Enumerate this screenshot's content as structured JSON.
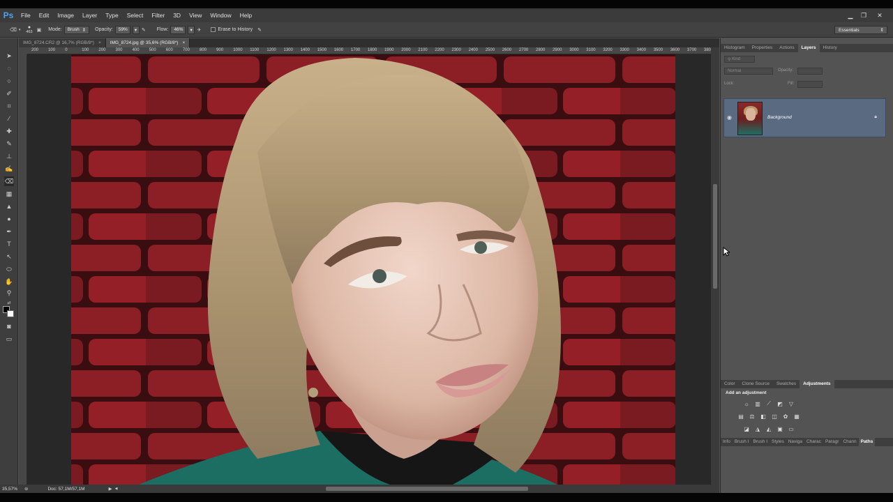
{
  "app": {
    "logo": "Ps",
    "menu": [
      "File",
      "Edit",
      "Image",
      "Layer",
      "Type",
      "Select",
      "Filter",
      "3D",
      "View",
      "Window",
      "Help"
    ]
  },
  "options": {
    "brush_size": "463",
    "mode_label": "Mode:",
    "mode_value": "Brush",
    "opacity_label": "Opacity:",
    "opacity_value": "59%",
    "flow_label": "Flow:",
    "flow_value": "46%",
    "erase_to_history": "Erase to History",
    "workspace": "Essentials"
  },
  "tabs": [
    {
      "label": "IMG_8724.CR2 @ 16,7% (RGB/8*)",
      "close": "×"
    },
    {
      "label": "IMG_8724.jpg @ 35,6% (RGB/8*)",
      "close": "×"
    }
  ],
  "ruler_ticks": [
    "200",
    "100",
    "0",
    "100",
    "200",
    "300",
    "400",
    "500",
    "600",
    "700",
    "800",
    "900",
    "1000",
    "1100",
    "1200",
    "1300",
    "1400",
    "1500",
    "1600",
    "1700",
    "1800",
    "1900",
    "2000",
    "2100",
    "2200",
    "2300",
    "2400",
    "2500",
    "2600",
    "2700",
    "2800",
    "2900",
    "3000",
    "3100",
    "3200",
    "3300",
    "3400",
    "3500",
    "3600",
    "3700",
    "3800"
  ],
  "status": {
    "zoom": "35,57%",
    "doc": "Doc: 57,1M/57,1M"
  },
  "panels": {
    "top_tabs": [
      "Histogram",
      "Properties",
      "Actions",
      "Layers",
      "History"
    ],
    "active_top": "Layers",
    "kind_label": "Kind",
    "blend_mode": "Normal",
    "opacity_label": "Opacity:",
    "lock_label": "Lock:",
    "fill_label": "Fill:",
    "layer_name": "Background",
    "mid_tabs": [
      "Color",
      "Clone Source",
      "Swatches",
      "Adjustments"
    ],
    "active_mid": "Adjustments",
    "add_adjustment": "Add an adjustment",
    "bottom_tabs": [
      "Info",
      "Brush I",
      "Brush I",
      "Styles",
      "Naviga",
      "Charac",
      "Paragr",
      "Chann",
      "Paths"
    ],
    "active_bottom": "Paths"
  },
  "colors": {
    "accent_layer": "#5a6a80",
    "ps_blue": "#4aa3f0"
  }
}
